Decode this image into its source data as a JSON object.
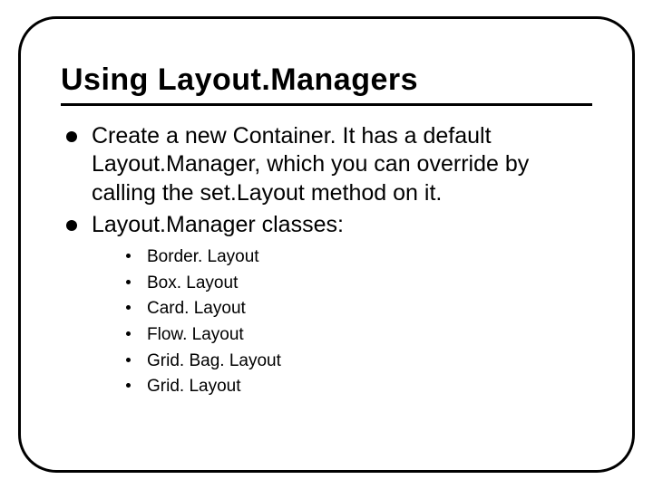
{
  "title": "Using Layout.Managers",
  "bullets": [
    "Create a new Container.  It has a default Layout.Manager, which you can override by calling the set.Layout method on it.",
    "Layout.Manager classes:"
  ],
  "subbullets": [
    "Border. Layout",
    "Box. Layout",
    "Card. Layout",
    "Flow. Layout",
    "Grid. Bag. Layout",
    "Grid. Layout"
  ]
}
